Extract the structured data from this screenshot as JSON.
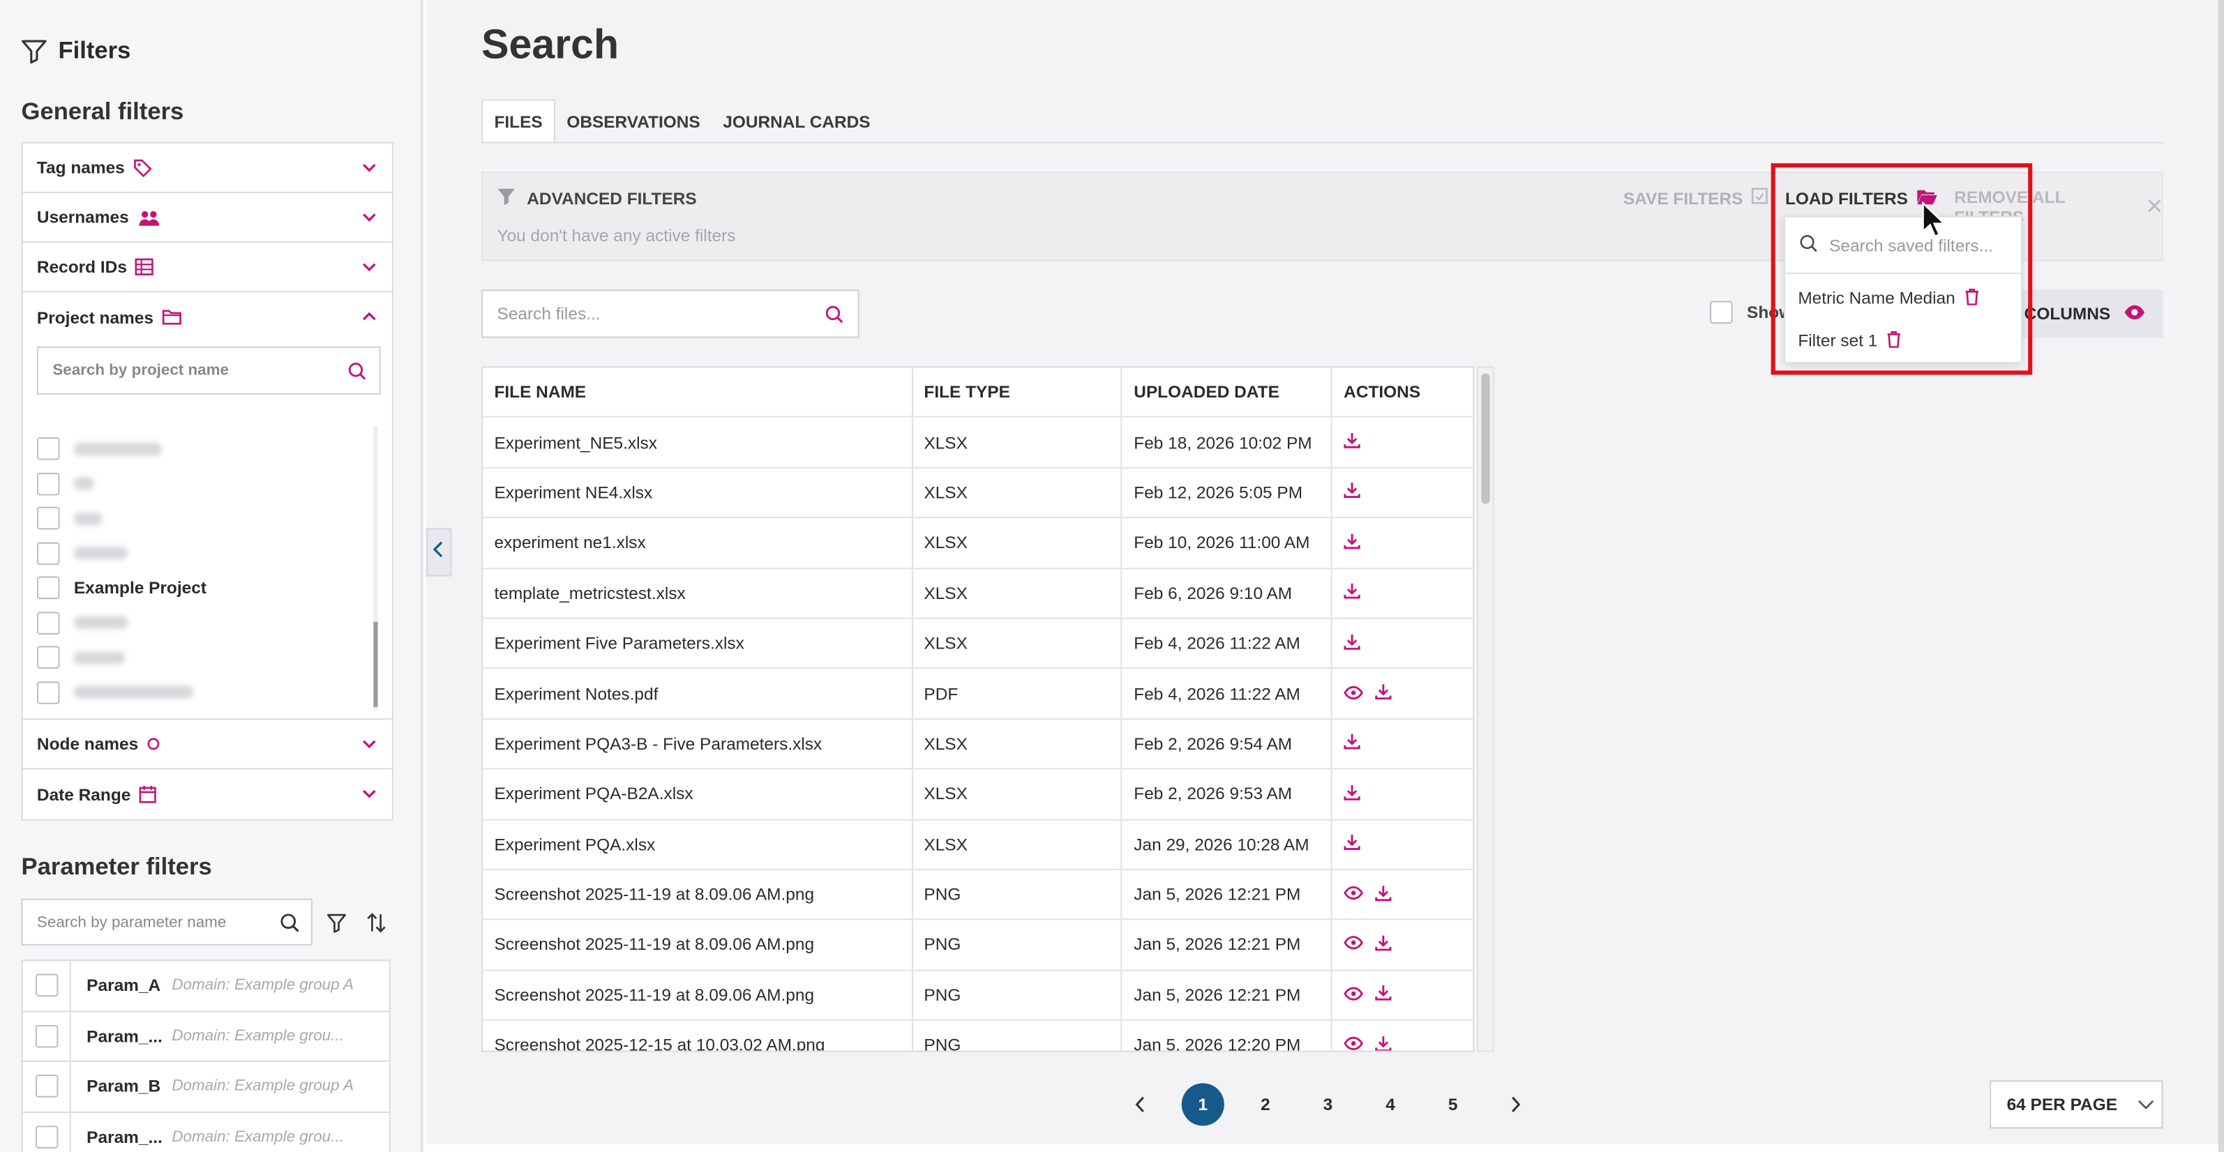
{
  "sidebar": {
    "title": "Filters",
    "general_heading": "General filters",
    "accordion": [
      {
        "label": "Tag names",
        "icon": "tag-icon"
      },
      {
        "label": "Usernames",
        "icon": "users-icon"
      },
      {
        "label": "Record IDs",
        "icon": "table-icon"
      },
      {
        "label": "Project names",
        "icon": "folder-icon",
        "expanded": true
      },
      {
        "label": "Node names",
        "icon": "circle-icon"
      },
      {
        "label": "Date Range",
        "icon": "calendar-icon"
      }
    ],
    "project_search_placeholder": "Search by project name",
    "project_items": [
      {
        "label": "",
        "blurred": true
      },
      {
        "label": "",
        "blurred": true
      },
      {
        "label": "",
        "blurred": true
      },
      {
        "label": "",
        "blurred": true
      },
      {
        "label": "Example Project",
        "blurred": false
      },
      {
        "label": "",
        "blurred": true
      },
      {
        "label": "",
        "blurred": true
      },
      {
        "label": "",
        "blurred": true
      }
    ],
    "parameter_heading": "Parameter filters",
    "parameter_search_placeholder": "Search by parameter name",
    "parameters": [
      {
        "name": "Param_A",
        "domain": "Domain: Example group A"
      },
      {
        "name": "Param_...",
        "domain": "Domain: Example grou..."
      },
      {
        "name": "Param_B",
        "domain": "Domain: Example group A"
      },
      {
        "name": "Param_...",
        "domain": "Domain: Example grou..."
      }
    ]
  },
  "main": {
    "title": "Search",
    "tabs": [
      "FILES",
      "OBSERVATIONS",
      "JOURNAL CARDS"
    ],
    "active_tab": "FILES",
    "advanced_filters_label": "ADVANCED FILTERS",
    "no_filters_text": "You don't have any active filters",
    "save_filters": "SAVE FILTERS",
    "load_filters": "LOAD FILTERS",
    "remove_all_filters": "REMOVE ALL FILTERS",
    "file_search_placeholder": "Search files...",
    "show_label": "Show",
    "columns_label": "COLUMNS",
    "table_headers": [
      "FILE NAME",
      "FILE TYPE",
      "UPLOADED DATE",
      "ACTIONS"
    ],
    "files": [
      {
        "name": "Experiment_NE5.xlsx",
        "type": "XLSX",
        "date": "Feb 18, 2026 10:02 PM",
        "view": false
      },
      {
        "name": "Experiment NE4.xlsx",
        "type": "XLSX",
        "date": "Feb 12, 2026 5:05 PM",
        "view": false
      },
      {
        "name": "experiment ne1.xlsx",
        "type": "XLSX",
        "date": "Feb 10, 2026 11:00 AM",
        "view": false
      },
      {
        "name": "template_metricstest.xlsx",
        "type": "XLSX",
        "date": "Feb 6, 2026 9:10 AM",
        "view": false
      },
      {
        "name": "Experiment Five Parameters.xlsx",
        "type": "XLSX",
        "date": "Feb 4, 2026 11:22 AM",
        "view": false
      },
      {
        "name": "Experiment Notes.pdf",
        "type": "PDF",
        "date": "Feb 4, 2026 11:22 AM",
        "view": true
      },
      {
        "name": "Experiment PQA3-B - Five Parameters.xlsx",
        "type": "XLSX",
        "date": "Feb 2, 2026 9:54 AM",
        "view": false
      },
      {
        "name": "Experiment PQA-B2A.xlsx",
        "type": "XLSX",
        "date": "Feb 2, 2026 9:53 AM",
        "view": false
      },
      {
        "name": "Experiment PQA.xlsx",
        "type": "XLSX",
        "date": "Jan 29, 2026 10:28 AM",
        "view": false
      },
      {
        "name": "Screenshot 2025-11-19 at 8.09.06 AM.png",
        "type": "PNG",
        "date": "Jan 5, 2026 12:21 PM",
        "view": true
      },
      {
        "name": "Screenshot 2025-11-19 at 8.09.06 AM.png",
        "type": "PNG",
        "date": "Jan 5, 2026 12:21 PM",
        "view": true
      },
      {
        "name": "Screenshot 2025-11-19 at 8.09.06 AM.png",
        "type": "PNG",
        "date": "Jan 5, 2026 12:21 PM",
        "view": true
      },
      {
        "name": "Screenshot 2025-12-15 at 10.03.02 AM.png",
        "type": "PNG",
        "date": "Jan 5, 2026 12:20 PM",
        "view": true
      }
    ],
    "pages": [
      "1",
      "2",
      "3",
      "4",
      "5"
    ],
    "current_page": "1",
    "per_page": "64 PER PAGE"
  },
  "load_dropdown": {
    "search_placeholder": "Search saved filters...",
    "items": [
      "Metric Name Median",
      "Filter set 1"
    ]
  },
  "colors": {
    "accent": "#c4127a",
    "pager_active": "#155a8a",
    "highlight": "#e0101a"
  }
}
